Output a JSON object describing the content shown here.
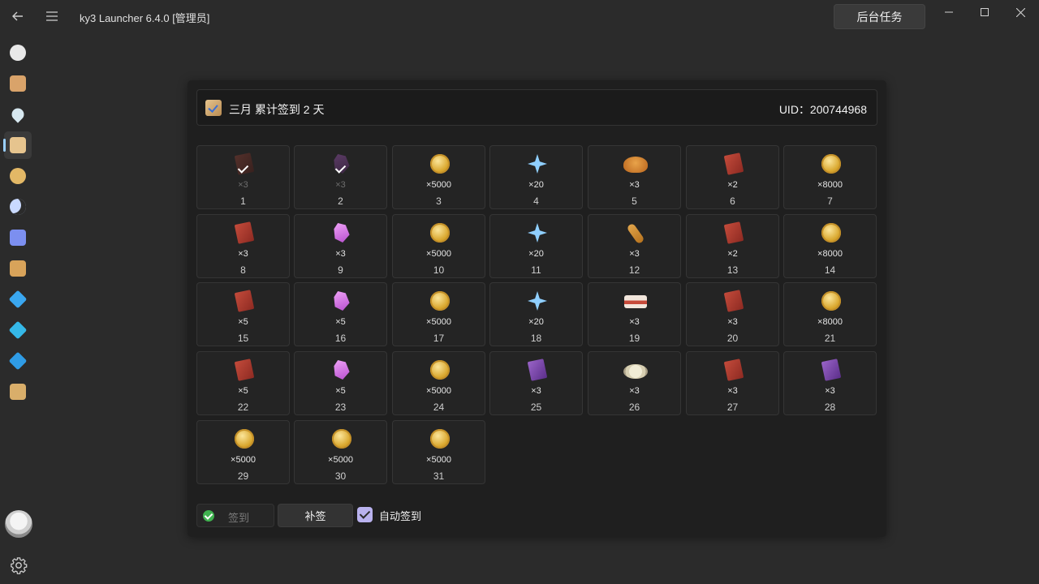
{
  "app": {
    "title": "ky3 Launcher 6.4.0 [管理员]",
    "background_tasks_label": "后台任务"
  },
  "window_controls": {
    "minimize": "—",
    "maximize": "☐",
    "close": "✕"
  },
  "topbar": {
    "back_glyph": "←",
    "menu_glyph": "☰"
  },
  "sidebar": {
    "items": [
      {
        "name": "paimon-icon",
        "color": "#e8e8e8"
      },
      {
        "name": "wish-scroll-icon",
        "color": "#d9a36a"
      },
      {
        "name": "location-pin-icon",
        "color": "#d7e8f0"
      },
      {
        "name": "daily-checkin-icon",
        "color": "#e6c48e",
        "active": true
      },
      {
        "name": "achievement-icon",
        "color": "#e3b866"
      },
      {
        "name": "moon-icon",
        "color": "#c9d9ff"
      },
      {
        "name": "star-rail-icon",
        "color": "#7c8ff0"
      },
      {
        "name": "card-game-icon",
        "color": "#d8a35a"
      },
      {
        "name": "diamond-blue-icon",
        "color": "#3aa7f0"
      },
      {
        "name": "diamond-cyan-icon",
        "color": "#35b8e8"
      },
      {
        "name": "diamond-azure-icon",
        "color": "#2f9ce6"
      },
      {
        "name": "scroll-gold-icon",
        "color": "#d9ae6a"
      }
    ]
  },
  "header": {
    "title": "三月 累计签到 2 天",
    "uid": "UID：200744968"
  },
  "rewards": [
    {
      "day": "1",
      "qty": "×3",
      "type": "book-dark",
      "signed": true
    },
    {
      "day": "2",
      "qty": "×3",
      "type": "crystal-dark",
      "signed": true
    },
    {
      "day": "3",
      "qty": "×5000",
      "type": "coin"
    },
    {
      "day": "4",
      "qty": "×20",
      "type": "star"
    },
    {
      "day": "5",
      "qty": "×3",
      "type": "food-chicken"
    },
    {
      "day": "6",
      "qty": "×2",
      "type": "book"
    },
    {
      "day": "7",
      "qty": "×8000",
      "type": "coin"
    },
    {
      "day": "8",
      "qty": "×3",
      "type": "book"
    },
    {
      "day": "9",
      "qty": "×3",
      "type": "crystal"
    },
    {
      "day": "10",
      "qty": "×5000",
      "type": "coin"
    },
    {
      "day": "11",
      "qty": "×20",
      "type": "star"
    },
    {
      "day": "12",
      "qty": "×3",
      "type": "food-skewer"
    },
    {
      "day": "13",
      "qty": "×2",
      "type": "book"
    },
    {
      "day": "14",
      "qty": "×8000",
      "type": "coin"
    },
    {
      "day": "15",
      "qty": "×5",
      "type": "book"
    },
    {
      "day": "16",
      "qty": "×5",
      "type": "crystal"
    },
    {
      "day": "17",
      "qty": "×5000",
      "type": "coin"
    },
    {
      "day": "18",
      "qty": "×20",
      "type": "star"
    },
    {
      "day": "19",
      "qty": "×3",
      "type": "food-meat"
    },
    {
      "day": "20",
      "qty": "×3",
      "type": "book"
    },
    {
      "day": "21",
      "qty": "×8000",
      "type": "coin"
    },
    {
      "day": "22",
      "qty": "×5",
      "type": "book"
    },
    {
      "day": "23",
      "qty": "×5",
      "type": "crystal"
    },
    {
      "day": "24",
      "qty": "×5000",
      "type": "coin"
    },
    {
      "day": "25",
      "qty": "×3",
      "type": "purple-book"
    },
    {
      "day": "26",
      "qty": "×3",
      "type": "food-rice"
    },
    {
      "day": "27",
      "qty": "×3",
      "type": "book"
    },
    {
      "day": "28",
      "qty": "×3",
      "type": "purple-book"
    },
    {
      "day": "29",
      "qty": "×5000",
      "type": "coin"
    },
    {
      "day": "30",
      "qty": "×5000",
      "type": "coin"
    },
    {
      "day": "31",
      "qty": "×5000",
      "type": "coin"
    }
  ],
  "footer": {
    "sign_label": "签到",
    "makeup_label": "补签",
    "auto_sign_label": "自动签到",
    "auto_sign_checked": true
  }
}
